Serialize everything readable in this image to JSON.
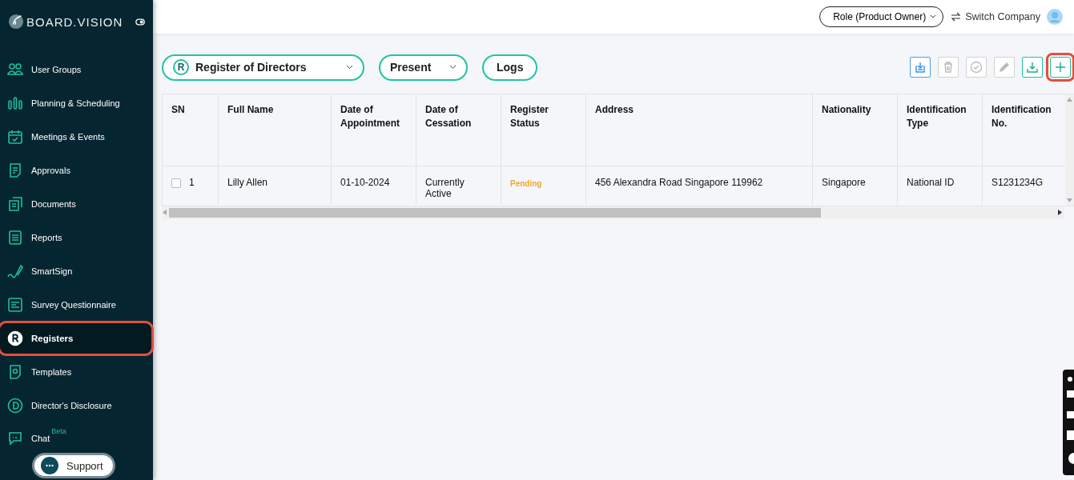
{
  "sidebar": {
    "logo": "BOARD.VISION",
    "items": [
      {
        "label": "User Groups",
        "selected": false,
        "highlighted": false
      },
      {
        "label": "Planning & Scheduling",
        "selected": false,
        "highlighted": false
      },
      {
        "label": "Meetings & Events",
        "selected": false,
        "highlighted": false
      },
      {
        "label": "Approvals",
        "selected": false,
        "highlighted": false
      },
      {
        "label": "Documents",
        "selected": false,
        "highlighted": false
      },
      {
        "label": "Reports",
        "selected": false,
        "highlighted": false
      },
      {
        "label": "SmartSign",
        "selected": false,
        "highlighted": false
      },
      {
        "label": "Survey Questionnaire",
        "selected": false,
        "highlighted": false
      },
      {
        "label": "Registers",
        "selected": true,
        "highlighted": true
      },
      {
        "label": "Templates",
        "selected": false,
        "highlighted": false
      },
      {
        "label": "Director's Disclosure",
        "selected": false,
        "highlighted": false
      },
      {
        "label": "Chat",
        "badge": "Beta",
        "selected": false,
        "highlighted": false
      }
    ],
    "support": "Support"
  },
  "header": {
    "role": "Role (Product Owner)",
    "switch": "Switch Company"
  },
  "filters": [
    {
      "label": "Register of Directors",
      "kind": "dropdown",
      "icon": "R"
    },
    {
      "label": "Present",
      "kind": "dropdown"
    },
    {
      "label": "Logs",
      "kind": "button"
    }
  ],
  "toolbar": [
    {
      "kind": "import",
      "disabled": false,
      "highlighted": false
    },
    {
      "kind": "delete",
      "disabled": true,
      "highlighted": false
    },
    {
      "kind": "approve",
      "disabled": true,
      "highlighted": false
    },
    {
      "kind": "edit",
      "disabled": true,
      "highlighted": false
    },
    {
      "kind": "download",
      "disabled": false,
      "highlighted": false
    },
    {
      "kind": "add",
      "disabled": false,
      "highlighted": true
    }
  ],
  "table": {
    "columns": [
      "SN",
      "Full Name",
      "Date of Appointment",
      "Date of Cessation",
      "Register Status",
      "Address",
      "Nationality",
      "Identification Type",
      "Identification No."
    ],
    "rows": [
      {
        "checked": false,
        "cells": [
          "1",
          "Lilly Allen",
          "01-10-2024",
          "Currently Active",
          "Pending",
          "456 Alexandra Road Singapore 119962",
          "Singapore",
          "National ID",
          "S1231234G"
        ]
      }
    ]
  }
}
